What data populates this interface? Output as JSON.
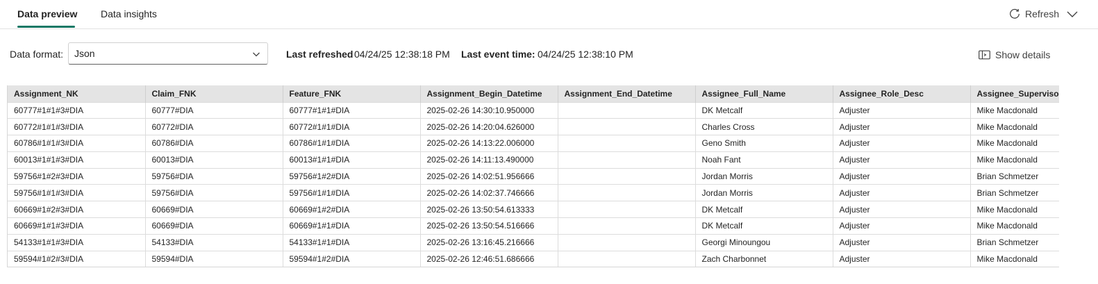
{
  "tabs": [
    {
      "label": "Data preview",
      "active": true
    },
    {
      "label": "Data insights",
      "active": false
    }
  ],
  "header": {
    "refresh_label": "Refresh",
    "refresh_icon": "refresh-icon",
    "collapse_icon": "chevron-down-icon"
  },
  "toolbar": {
    "format_label": "Data format:",
    "format_value": "Json",
    "last_refreshed_label": "Last refreshed",
    "last_refreshed_value": "04/24/25 12:38:18 PM",
    "last_event_label": "Last event time:",
    "last_event_value": "04/24/25 12:38:10 PM",
    "show_details_label": "Show details",
    "show_details_icon": "details-panel-icon"
  },
  "colors": {
    "accent": "#117865",
    "header_bg": "#e4e4e4"
  },
  "table": {
    "columns": [
      "Assignment_NK",
      "Claim_FNK",
      "Feature_FNK",
      "Assignment_Begin_Datetime",
      "Assignment_End_Datetime",
      "Assignee_Full_Name",
      "Assignee_Role_Desc",
      "Assignee_Supervisor_"
    ],
    "rows": [
      [
        "60777#1#1#3#DIA",
        "60777#DIA",
        "60777#1#1#DIA",
        "2025-02-26 14:30:10.950000",
        "",
        "DK Metcalf",
        "Adjuster",
        "Mike Macdonald"
      ],
      [
        "60772#1#1#3#DIA",
        "60772#DIA",
        "60772#1#1#DIA",
        "2025-02-26 14:20:04.626000",
        "",
        "Charles Cross",
        "Adjuster",
        "Mike Macdonald"
      ],
      [
        "60786#1#1#3#DIA",
        "60786#DIA",
        "60786#1#1#DIA",
        "2025-02-26 14:13:22.006000",
        "",
        "Geno Smith",
        "Adjuster",
        "Mike Macdonald"
      ],
      [
        "60013#1#1#3#DIA",
        "60013#DIA",
        "60013#1#1#DIA",
        "2025-02-26 14:11:13.490000",
        "",
        "Noah Fant",
        "Adjuster",
        "Mike Macdonald"
      ],
      [
        "59756#1#2#3#DIA",
        "59756#DIA",
        "59756#1#2#DIA",
        "2025-02-26 14:02:51.956666",
        "",
        "Jordan Morris",
        "Adjuster",
        "Brian Schmetzer"
      ],
      [
        "59756#1#1#3#DIA",
        "59756#DIA",
        "59756#1#1#DIA",
        "2025-02-26 14:02:37.746666",
        "",
        "Jordan Morris",
        "Adjuster",
        "Brian Schmetzer"
      ],
      [
        "60669#1#2#3#DIA",
        "60669#DIA",
        "60669#1#2#DIA",
        "2025-02-26 13:50:54.613333",
        "",
        "DK Metcalf",
        "Adjuster",
        "Mike Macdonald"
      ],
      [
        "60669#1#1#3#DIA",
        "60669#DIA",
        "60669#1#1#DIA",
        "2025-02-26 13:50:54.516666",
        "",
        "DK Metcalf",
        "Adjuster",
        "Mike Macdonald"
      ],
      [
        "54133#1#1#3#DIA",
        "54133#DIA",
        "54133#1#1#DIA",
        "2025-02-26 13:16:45.216666",
        "",
        "Georgi Minoungou",
        "Adjuster",
        "Brian Schmetzer"
      ],
      [
        "59594#1#2#3#DIA",
        "59594#DIA",
        "59594#1#2#DIA",
        "2025-02-26 12:46:51.686666",
        "",
        "Zach Charbonnet",
        "Adjuster",
        "Mike Macdonald"
      ]
    ]
  }
}
